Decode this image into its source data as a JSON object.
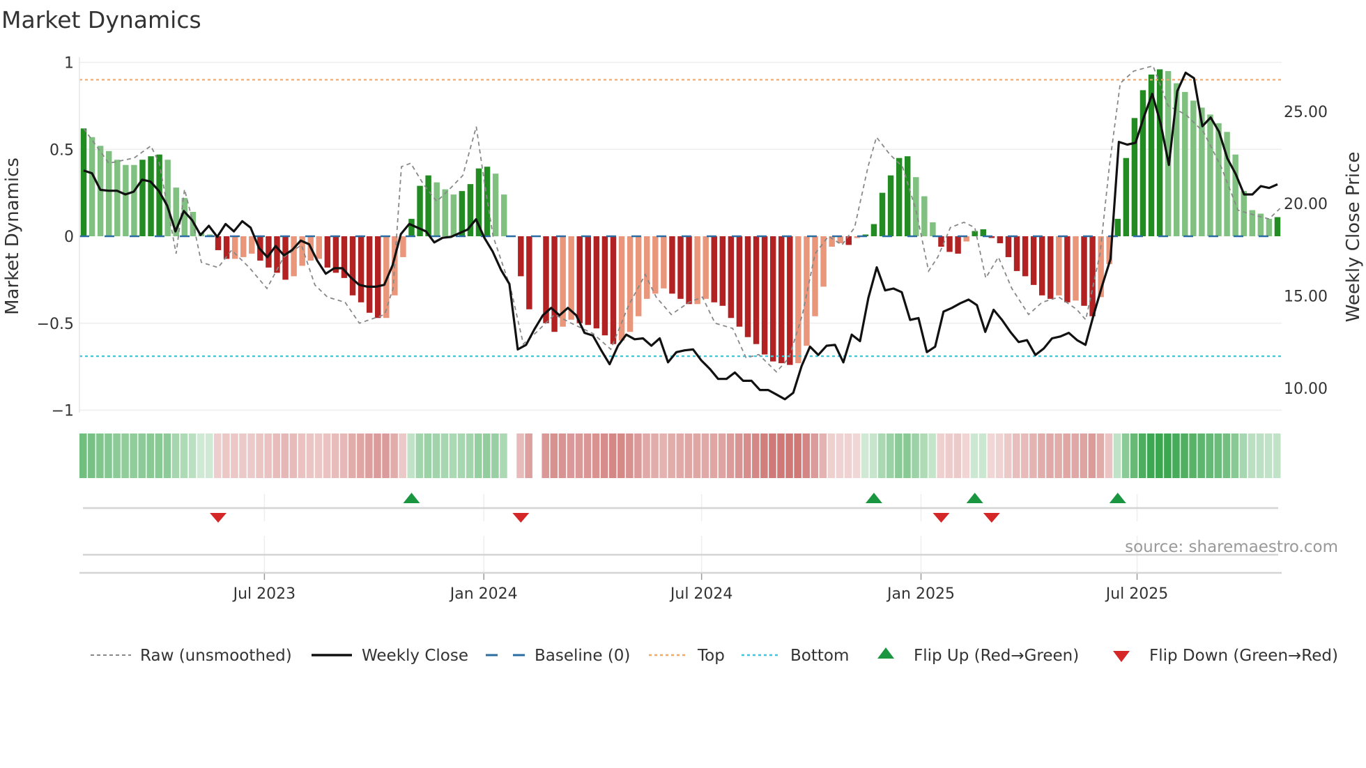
{
  "title": "Market Dynamics",
  "source": "source: sharemaestro.com",
  "colors": {
    "up_strong": "#228b22",
    "up_weak": "#80c080",
    "down_strong": "#b22222",
    "down_weak": "#e9967a",
    "close": "#111111",
    "raw": "#888888",
    "baseline": "#2b6ca3",
    "top": "#f0a868",
    "bottom": "#3fc6d8",
    "flip_up": "#1a9641",
    "flip_down": "#d62728",
    "strip_green": "46,160,67",
    "strip_red": "192,80,77"
  },
  "chart_data": {
    "type": "bar",
    "title": "Market Dynamics",
    "ylabel": "Market Dynamics",
    "y2label": "Weekly Close Price",
    "ylim": [
      -1,
      1
    ],
    "y2lim": [
      8.79,
      27.64
    ],
    "grid": true,
    "legend_position": "bottom",
    "yticks": [
      {
        "v": 1,
        "label": "1"
      },
      {
        "v": 0.5,
        "label": "0.5"
      },
      {
        "v": 0,
        "label": "0"
      },
      {
        "v": -0.5,
        "label": "−0.5"
      },
      {
        "v": -1,
        "label": "−1"
      }
    ],
    "y2ticks": [
      {
        "v": 25,
        "label": "25.00"
      },
      {
        "v": 20,
        "label": "20.00"
      },
      {
        "v": 15,
        "label": "15.00"
      },
      {
        "v": 10,
        "label": "10.00"
      }
    ],
    "xticks": [
      {
        "week": 21.5,
        "label": "Jul 2023"
      },
      {
        "week": 47.6,
        "label": "Jan 2024"
      },
      {
        "week": 73.5,
        "label": "Jul 2024"
      },
      {
        "week": 99.6,
        "label": "Jan 2025"
      },
      {
        "week": 125.3,
        "label": "Jul 2025"
      }
    ],
    "top": 0.9,
    "bottom": -0.69,
    "baseline": 0,
    "momentum": [
      0.62,
      0.57,
      0.52,
      0.49,
      0.44,
      0.41,
      0.41,
      0.44,
      0.46,
      0.47,
      0.44,
      0.28,
      0.22,
      0.14,
      0.02,
      0.01,
      -0.08,
      -0.13,
      -0.13,
      -0.12,
      -0.1,
      -0.14,
      -0.18,
      -0.21,
      -0.25,
      -0.23,
      -0.17,
      -0.14,
      -0.13,
      -0.18,
      -0.21,
      -0.24,
      -0.34,
      -0.38,
      -0.44,
      -0.47,
      -0.47,
      -0.34,
      -0.12,
      0.1,
      0.29,
      0.35,
      0.31,
      0.27,
      0.24,
      0.26,
      0.3,
      0.39,
      0.4,
      0.36,
      0.24,
      0.0,
      -0.23,
      -0.42,
      0.0,
      -0.5,
      -0.55,
      -0.52,
      -0.48,
      -0.5,
      -0.51,
      -0.53,
      -0.57,
      -0.62,
      -0.6,
      -0.55,
      -0.46,
      -0.36,
      -0.33,
      -0.3,
      -0.33,
      -0.36,
      -0.39,
      -0.39,
      -0.36,
      -0.38,
      -0.4,
      -0.47,
      -0.52,
      -0.58,
      -0.62,
      -0.68,
      -0.72,
      -0.73,
      -0.74,
      -0.73,
      -0.63,
      -0.46,
      -0.29,
      -0.06,
      -0.04,
      -0.05,
      -0.01,
      0.01,
      0.07,
      0.25,
      0.35,
      0.45,
      0.46,
      0.34,
      0.23,
      0.08,
      -0.06,
      -0.09,
      -0.1,
      -0.03,
      0.03,
      0.04,
      -0.01,
      -0.04,
      -0.12,
      -0.2,
      -0.23,
      -0.28,
      -0.34,
      -0.36,
      -0.34,
      -0.38,
      -0.37,
      -0.4,
      -0.46,
      -0.35,
      -0.16,
      0.1,
      0.45,
      0.68,
      0.84,
      0.93,
      0.96,
      0.95,
      0.88,
      0.83,
      0.78,
      0.74,
      0.7,
      0.65,
      0.6,
      0.47,
      0.26,
      0.15,
      0.13,
      0.1,
      0.11
    ],
    "weekly_close": [
      21.8,
      21.65,
      20.75,
      20.7,
      20.7,
      20.5,
      20.65,
      21.3,
      21.2,
      20.7,
      19.9,
      18.5,
      19.6,
      19.1,
      18.3,
      18.8,
      18.2,
      18.9,
      18.5,
      19.05,
      18.7,
      17.6,
      17.1,
      17.7,
      17.2,
      17.5,
      18.0,
      17.8,
      16.9,
      16.2,
      16.5,
      16.5,
      16.0,
      15.6,
      15.5,
      15.5,
      15.6,
      16.65,
      18.35,
      18.9,
      18.7,
      18.5,
      17.9,
      18.15,
      18.2,
      18.4,
      18.6,
      19.15,
      18.15,
      17.4,
      16.4,
      15.65,
      12.1,
      12.35,
      13.2,
      13.95,
      14.35,
      13.95,
      14.35,
      13.95,
      13.0,
      12.85,
      12.05,
      11.3,
      12.3,
      12.9,
      12.65,
      12.7,
      12.3,
      12.7,
      11.4,
      11.95,
      12.05,
      12.1,
      11.5,
      11.05,
      10.5,
      10.5,
      10.85,
      10.4,
      10.4,
      9.9,
      9.9,
      9.65,
      9.4,
      9.75,
      11.2,
      12.25,
      11.8,
      12.3,
      12.35,
      11.4,
      12.9,
      12.55,
      14.9,
      16.55,
      15.3,
      15.4,
      15.2,
      13.7,
      13.8,
      11.95,
      12.25,
      14.15,
      14.35,
      14.6,
      14.8,
      14.5,
      13.05,
      14.25,
      13.7,
      13.05,
      12.5,
      12.6,
      11.8,
      12.15,
      12.7,
      12.8,
      13.0,
      12.6,
      12.35,
      14.0,
      15.55,
      17.0,
      23.35,
      23.2,
      23.3,
      24.7,
      25.95,
      24.35,
      22.1,
      26.1,
      27.1,
      26.8,
      24.2,
      24.67,
      23.9,
      22.45,
      21.6,
      20.5,
      20.5,
      20.95,
      20.85,
      21.05
    ],
    "raw": [
      [
        0,
        0.62
      ],
      [
        3,
        0.42
      ],
      [
        6,
        0.45
      ],
      [
        8,
        0.52
      ],
      [
        9,
        0.42
      ],
      [
        11,
        -0.1
      ],
      [
        12,
        0.27
      ],
      [
        13,
        0.08
      ],
      [
        14,
        -0.15
      ],
      [
        16,
        -0.18
      ],
      [
        17.6,
        -0.08
      ],
      [
        19.7,
        -0.18
      ],
      [
        21.8,
        -0.3
      ],
      [
        23.8,
        -0.12
      ],
      [
        25.9,
        -0.05
      ],
      [
        27.5,
        -0.28
      ],
      [
        29,
        -0.35
      ],
      [
        31.1,
        -0.38
      ],
      [
        32.8,
        -0.5
      ],
      [
        35.8,
        -0.45
      ],
      [
        36.8,
        -0.3
      ],
      [
        37.8,
        0.4
      ],
      [
        38.9,
        0.42
      ],
      [
        40.4,
        0.3
      ],
      [
        42,
        0.2
      ],
      [
        43.5,
        0.27
      ],
      [
        45.1,
        0.35
      ],
      [
        46.7,
        0.63
      ],
      [
        47.7,
        0.3
      ],
      [
        48.7,
        0.0
      ],
      [
        50.8,
        -0.3
      ],
      [
        52.3,
        -0.62
      ],
      [
        53.9,
        -0.55
      ],
      [
        56,
        -0.45
      ],
      [
        58,
        -0.5
      ],
      [
        60.6,
        -0.56
      ],
      [
        62.7,
        -0.65
      ],
      [
        64.8,
        -0.4
      ],
      [
        66.8,
        -0.22
      ],
      [
        68.1,
        -0.35
      ],
      [
        69.9,
        -0.45
      ],
      [
        72,
        -0.38
      ],
      [
        73.6,
        -0.35
      ],
      [
        75.1,
        -0.5
      ],
      [
        77.2,
        -0.53
      ],
      [
        78.8,
        -0.7
      ],
      [
        80.3,
        -0.68
      ],
      [
        82.4,
        -0.78
      ],
      [
        83.9,
        -0.7
      ],
      [
        85.5,
        -0.45
      ],
      [
        87,
        -0.1
      ],
      [
        88.6,
        0.0
      ],
      [
        90.2,
        -0.05
      ],
      [
        91.7,
        0.05
      ],
      [
        93.3,
        0.4
      ],
      [
        94.3,
        0.57
      ],
      [
        95.9,
        0.47
      ],
      [
        97.4,
        0.4
      ],
      [
        99,
        0.15
      ],
      [
        100.5,
        -0.2
      ],
      [
        101.6,
        -0.12
      ],
      [
        103.1,
        0.05
      ],
      [
        104.7,
        0.08
      ],
      [
        106,
        0.05
      ],
      [
        107.3,
        -0.24
      ],
      [
        108.8,
        -0.12
      ],
      [
        110.4,
        -0.3
      ],
      [
        112.4,
        -0.45
      ],
      [
        114,
        -0.38
      ],
      [
        116,
        -0.35
      ],
      [
        118.1,
        -0.42
      ],
      [
        119.2,
        -0.48
      ],
      [
        120.9,
        -0.1
      ],
      [
        122,
        0.4
      ],
      [
        123.3,
        0.88
      ],
      [
        124.9,
        0.95
      ],
      [
        127.2,
        0.98
      ],
      [
        129,
        0.75
      ],
      [
        131.1,
        0.7
      ],
      [
        133.2,
        0.6
      ],
      [
        135.3,
        0.4
      ],
      [
        137.3,
        0.15
      ],
      [
        139.4,
        0.12
      ],
      [
        141,
        0.1
      ],
      [
        142.3,
        0.16
      ]
    ],
    "flip_up": [
      39,
      94,
      106,
      123
    ],
    "flip_down": [
      16,
      52,
      102,
      108
    ],
    "legend": [
      {
        "key": "raw",
        "label": "Raw (unsmoothed)"
      },
      {
        "key": "close",
        "label": "Weekly Close"
      },
      {
        "key": "baseline",
        "label": "Baseline (0)"
      },
      {
        "key": "top",
        "label": "Top"
      },
      {
        "key": "bottom",
        "label": "Bottom"
      },
      {
        "key": "flip_up",
        "label": "Flip Up (Red→Green)"
      },
      {
        "key": "flip_down",
        "label": "Flip Down (Green→Red)"
      }
    ]
  }
}
